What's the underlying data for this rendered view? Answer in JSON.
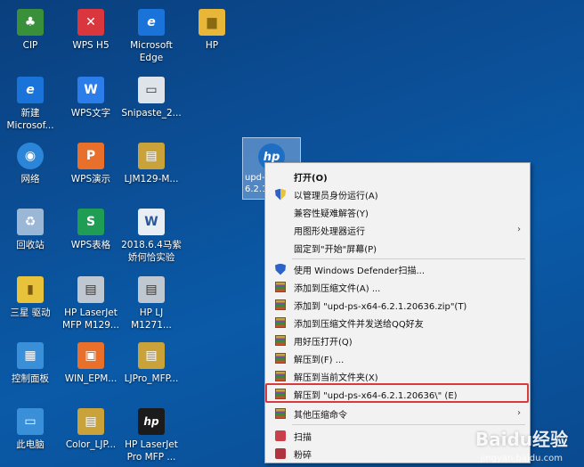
{
  "desktop": {
    "icons": [
      {
        "label": "CIP",
        "glyph": "♣",
        "color": "#3a8f3a"
      },
      {
        "label": "WPS H5",
        "glyph": "✕",
        "color": "#d9363e"
      },
      {
        "label": "Microsoft\nEdge",
        "glyph": "e",
        "color": "#1a73d9"
      },
      {
        "label": "HP",
        "glyph": "▆",
        "color": "#e8b73a"
      },
      {
        "label": "新建\nMicrosof...",
        "glyph": "e",
        "color": "#1a73d9"
      },
      {
        "label": "WPS文字",
        "glyph": "W",
        "color": "#2b7de9"
      },
      {
        "label": "Snipaste_2...",
        "glyph": "▭",
        "color": "#dfe4ea"
      },
      {
        "label": "网络",
        "glyph": "◉",
        "color": "#2b86d9"
      },
      {
        "label": "WPS演示",
        "glyph": "P",
        "color": "#e8702a"
      },
      {
        "label": "LJM129-M...",
        "glyph": "▤",
        "color": "#c9a23a"
      },
      {
        "label": "回收站",
        "glyph": "♻",
        "color": "#9ab7d6"
      },
      {
        "label": "WPS表格",
        "glyph": "S",
        "color": "#1f9d55"
      },
      {
        "label": "2018.6.4马紫\n娇何恰实验",
        "glyph": "W",
        "color": "#e9eef5"
      },
      {
        "label": "三星 驱动",
        "glyph": "▮",
        "color": "#e8c23a"
      },
      {
        "label": "HP LaserJet\nMFP M129...",
        "glyph": "▤",
        "color": "#bfc7d1"
      },
      {
        "label": "HP LJ\nM1271...",
        "glyph": "▤",
        "color": "#bfc7d1"
      },
      {
        "label": "控制面板",
        "glyph": "▦",
        "color": "#3a8fd9"
      },
      {
        "label": "WIN_EPM...",
        "glyph": "▣",
        "color": "#e8702a"
      },
      {
        "label": "LJPro_MFP...",
        "glyph": "▤",
        "color": "#c9a23a"
      },
      {
        "label": "此电脑",
        "glyph": "▭",
        "color": "#3a8fd9"
      },
      {
        "label": "Color_LJP...",
        "glyph": "▤",
        "color": "#c9a23a"
      },
      {
        "label": "HP LaserJet\nPro MFP ...",
        "glyph": "hp",
        "color": "#1b1b1b"
      }
    ],
    "selected_file": {
      "label": "upd-...\n6.2.1...",
      "logo": "hp"
    }
  },
  "context_menu": {
    "items": [
      {
        "label": "打开(O)",
        "icon": "none",
        "bold": true
      },
      {
        "label": "以管理员身份运行(A)",
        "icon": "uac-shield-icon"
      },
      {
        "label": "兼容性疑难解答(Y)",
        "icon": "none"
      },
      {
        "label": "用图形处理器运行",
        "icon": "none",
        "submenu": true
      },
      {
        "label": "固定到\"开始\"屏幕(P)",
        "icon": "none"
      },
      {
        "label": "使用 Windows Defender扫描...",
        "icon": "defender-shield-icon"
      },
      {
        "label": "添加到压缩文件(A) ...",
        "icon": "archive-icon"
      },
      {
        "label": "添加到 \"upd-ps-x64-6.2.1.20636.zip\"(T)",
        "icon": "archive-icon"
      },
      {
        "label": "添加到压缩文件并发送给QQ好友",
        "icon": "archive-icon"
      },
      {
        "label": "用好压打开(Q)",
        "icon": "archive-icon"
      },
      {
        "label": "解压到(F) ...",
        "icon": "archive-icon"
      },
      {
        "label": "解压到当前文件夹(X)",
        "icon": "archive-icon"
      },
      {
        "label": "解压到 \"upd-ps-x64-6.2.1.20636\\\" (E)",
        "icon": "archive-icon",
        "highlighted": true
      },
      {
        "label": "其他压缩命令",
        "icon": "archive-icon",
        "submenu": true
      },
      {
        "label": "扫描",
        "icon": "scan-icon"
      },
      {
        "label": "粉碎",
        "icon": "shred-icon"
      }
    ],
    "submenu_arrow": "›"
  },
  "watermark": {
    "brand": "Baidu经验",
    "url": "jingyan.baidu.com"
  },
  "colors": {
    "highlight_border": "#d83b3b",
    "menu_bg": "#f2f2f2"
  }
}
